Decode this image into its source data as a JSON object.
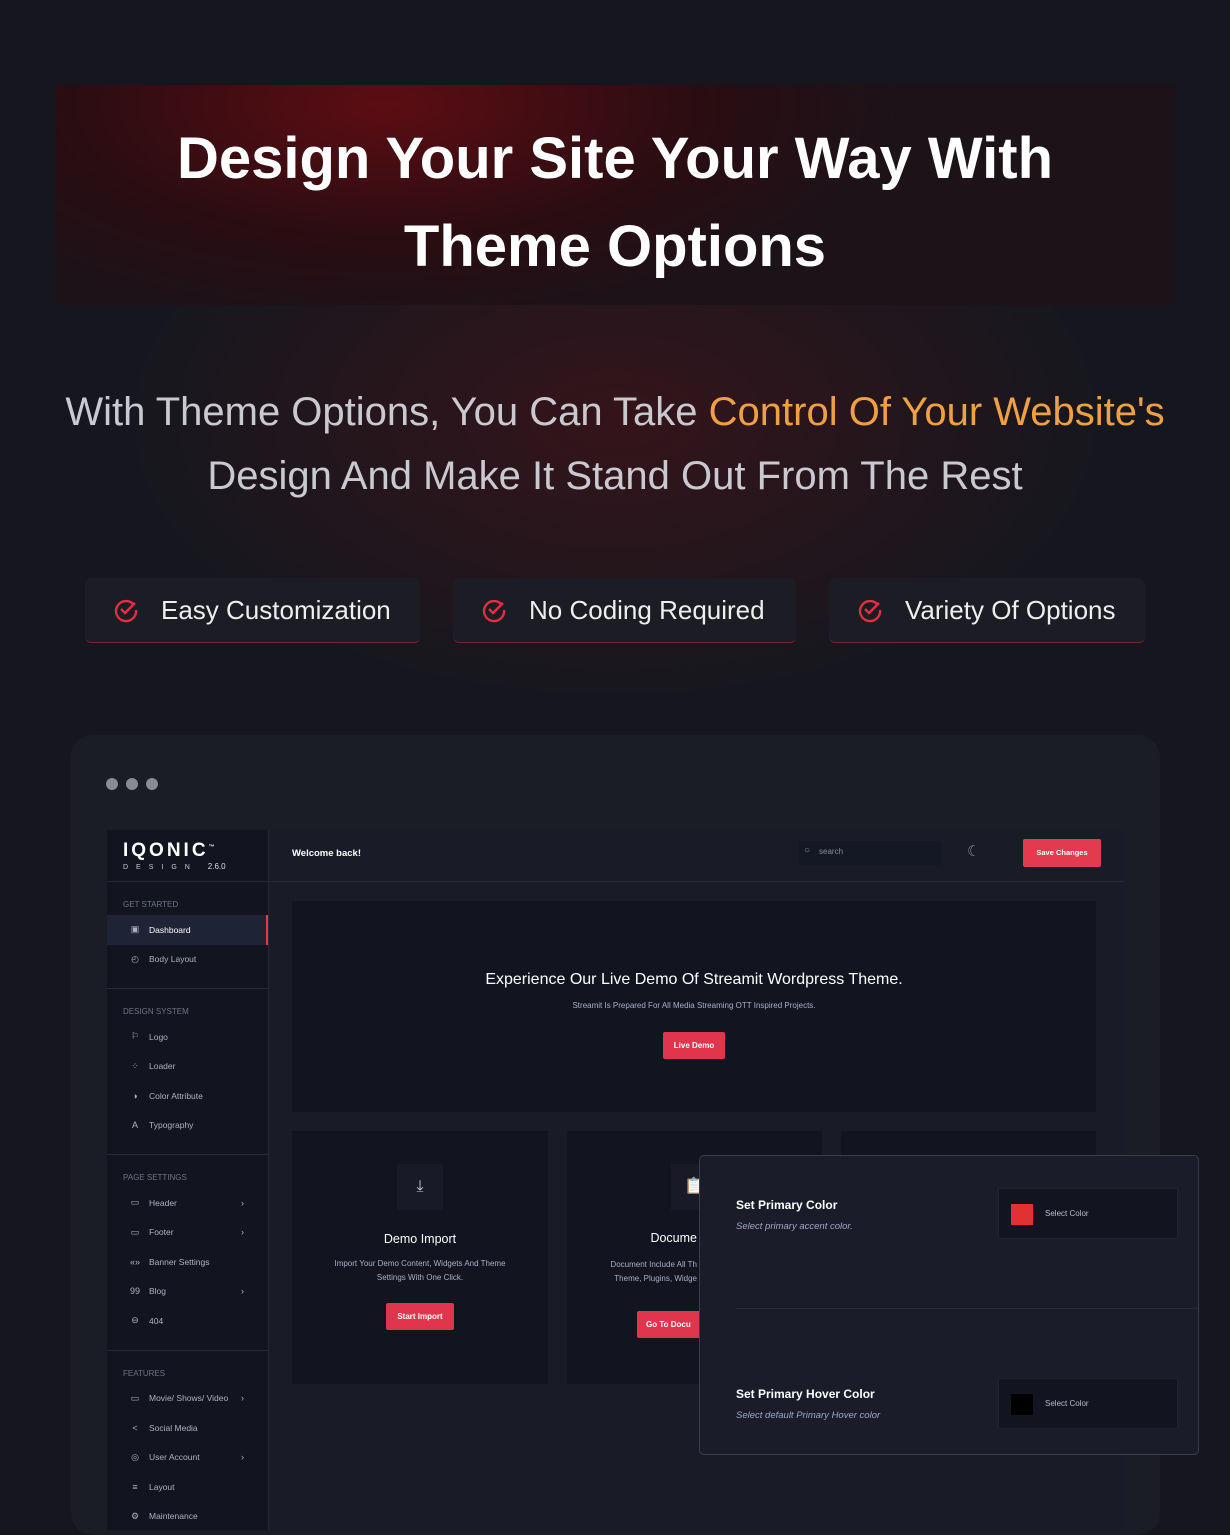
{
  "hero": {
    "title_line1": "Design Your Site Your Way With",
    "title_line2": "Theme Options"
  },
  "subtitle": {
    "part1": "With Theme Options, You Can Take ",
    "highlight": "Control Of Your Website's",
    "line2": "Design And Make It Stand Out From The Rest"
  },
  "features": [
    {
      "label": "Easy Customization",
      "icon": "check-circle-icon"
    },
    {
      "label": "No  Coding Required",
      "icon": "check-circle-icon"
    },
    {
      "label": "Variety Of Options",
      "icon": "check-circle-icon"
    }
  ],
  "colors": {
    "accent": "#e33a4f",
    "highlight": "#f0a040",
    "primary_swatch": "#e03232",
    "hover_swatch": "#000000"
  },
  "app": {
    "logo": {
      "name": "IQONIC",
      "tm": "™",
      "sub": "DESIGN",
      "version": "2.6.0"
    },
    "header": {
      "welcome": "Welcome back!",
      "search_placeholder": "search",
      "save": "Save Changes"
    },
    "sidebar": [
      {
        "section": "GET STARTED",
        "items": [
          {
            "label": "Dashboard",
            "icon": "▣",
            "active": true
          },
          {
            "label": "Body Layout",
            "icon": "◴"
          }
        ]
      },
      {
        "section": "DESIGN SYSTEM",
        "items": [
          {
            "label": "Logo",
            "icon": "⚐"
          },
          {
            "label": "Loader",
            "icon": "⁘"
          },
          {
            "label": "Color Attribute",
            "icon": "◑"
          },
          {
            "label": "Typography",
            "icon": "A"
          }
        ]
      },
      {
        "section": "PAGE SETTINGS",
        "items": [
          {
            "label": "Header",
            "icon": "▭",
            "chev": true
          },
          {
            "label": "Footer",
            "icon": "▭",
            "chev": true
          },
          {
            "label": "Banner Settings",
            "icon": "«»"
          },
          {
            "label": "Blog",
            "icon": "99",
            "chev": true
          },
          {
            "label": "404",
            "icon": "⊖"
          }
        ]
      },
      {
        "section": "FEATURES",
        "items": [
          {
            "label": "Movie/ Shows/ Video",
            "icon": "▭",
            "chev": true
          },
          {
            "label": "Social Media",
            "icon": "<"
          },
          {
            "label": "User Account",
            "icon": "◎",
            "chev": true
          },
          {
            "label": "Layout",
            "icon": "≡"
          },
          {
            "label": "Maintenance",
            "icon": "⚙"
          }
        ]
      }
    ],
    "demo": {
      "title": "Experience Our Live Demo Of Streamit Wordpress Theme.",
      "desc": "Streamit Is Prepared For All Media Streaming OTT Inspired Projects.",
      "button": "Live Demo"
    },
    "cards": [
      {
        "title": "Demo Import",
        "desc1": "Import Your Demo Content, Widgets And Theme",
        "desc2": "Settings With One Click.",
        "button": "Start Import"
      },
      {
        "title": "Docume",
        "desc1": "Document Include All Th",
        "desc2": "Theme, Plugins, Widge",
        "button": "Go To Docu"
      }
    ],
    "panel": [
      {
        "title": "Set Primary Color",
        "desc": "Select primary accent color.",
        "select": "Select Color"
      },
      {
        "title": "Set Primary Hover Color",
        "desc": "Select default Primary Hover color",
        "select": "Select Color"
      }
    ]
  }
}
